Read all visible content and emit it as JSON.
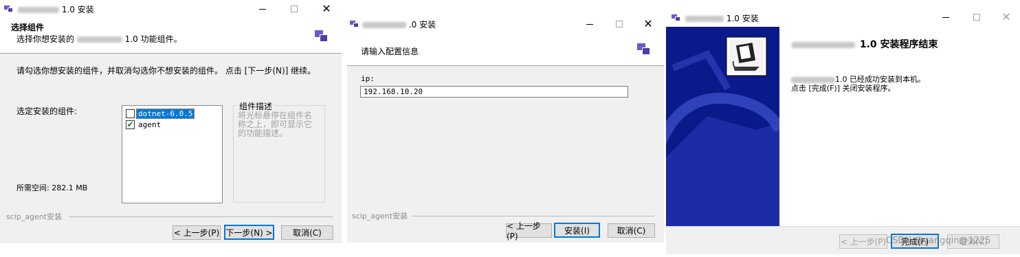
{
  "w1": {
    "title_suffix": "1.0 安装",
    "header_title": "选择组件",
    "header_subtitle_prefix": "选择你想安装的",
    "header_subtitle_suffix": "1.0 功能组件。",
    "instruction": "请勾选你想安装的组件，并取消勾选你不想安装的组件。 点击 [下一步(N)] 继续。",
    "select_label": "选定安装的组件:",
    "components": [
      {
        "label": "dotnet-6.0.5",
        "checked": false,
        "selected": true
      },
      {
        "label": "agent",
        "checked": true,
        "selected": false
      }
    ],
    "desc_title": "组件描述",
    "desc_text": "将光标悬停在组件名称之上，即可显示它的功能描述。",
    "space_label": "所需空间: 282.1 MB",
    "brand": "scip_agent安装",
    "btn_back": "< 上一步(P)",
    "btn_next": "下一步(N) >",
    "btn_cancel": "取消(C)"
  },
  "w2": {
    "title_suffix": ".0 安装",
    "header_title": "请输入配置信息",
    "ip_label": "ip:",
    "ip_value": "192.168.10.20",
    "brand": "scip_agent安装",
    "btn_back": "< 上一步(P)",
    "btn_install": "安装(I)",
    "btn_cancel": "取消(C)"
  },
  "w3": {
    "title_suffix": "1.0 安装",
    "finish_title": "1.0 安装程序结束",
    "line1": "1.0 已经成功安装到本机。",
    "line2": "点击 [完成(F)] 关闭安装程序。",
    "btn_back": "< 上一步(P)",
    "btn_finish": "完成(F)",
    "btn_cancel": "取消(C)",
    "watermark": "CSDN @yangqin@1225"
  },
  "colors": {
    "banner_blue": "#0b1a8a",
    "accent": "#0078d7",
    "selection": "#0078d7"
  }
}
